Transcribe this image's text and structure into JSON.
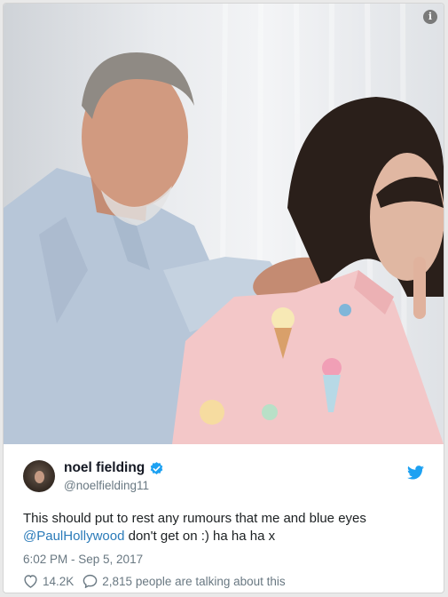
{
  "photo": {
    "subject": "tweet photo",
    "info_icon": "info-icon"
  },
  "tweet": {
    "display_name": "noel fielding",
    "handle": "@noelfielding11",
    "verified_icon": "verified-badge-icon",
    "bird_icon": "twitter-bird-icon",
    "text_before": "This should put to rest any rumours that me and blue eyes ",
    "mention": "@PaulHollywood",
    "text_after": " don't get on :) ha ha ha x",
    "timestamp": "6:02 PM - Sep 5, 2017",
    "likes": "14.2K",
    "talking": "2,815 people are talking about this",
    "like_icon": "heart-icon",
    "reply_icon": "speech-bubble-icon"
  },
  "colors": {
    "link": "#2b7bb9",
    "verified": "#1da1f2",
    "muted": "#697882",
    "text": "#1c2022"
  }
}
